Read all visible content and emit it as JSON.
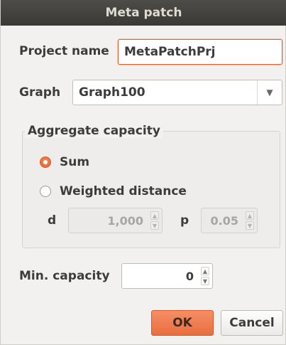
{
  "window": {
    "title": "Meta patch"
  },
  "project": {
    "label": "Project name",
    "value": "MetaPatchPrj"
  },
  "graph": {
    "label": "Graph",
    "selected": "Graph100"
  },
  "aggregate": {
    "title": "Aggregate capacity",
    "options": [
      {
        "label": "Sum",
        "checked": true
      },
      {
        "label": "Weighted distance",
        "checked": false
      }
    ],
    "d_label": "d",
    "d_value": "1,000",
    "p_label": "p",
    "p_value": "0.05"
  },
  "min_capacity": {
    "label": "Min. capacity",
    "value": "0"
  },
  "buttons": {
    "ok": "OK",
    "cancel": "Cancel"
  },
  "colors": {
    "accent": "#e96e3f",
    "titlebar": "#3c3b37"
  },
  "icons": {
    "dropdown": "chevron-down-icon",
    "spin_up": "spin-up-icon",
    "spin_down": "spin-down-icon"
  }
}
